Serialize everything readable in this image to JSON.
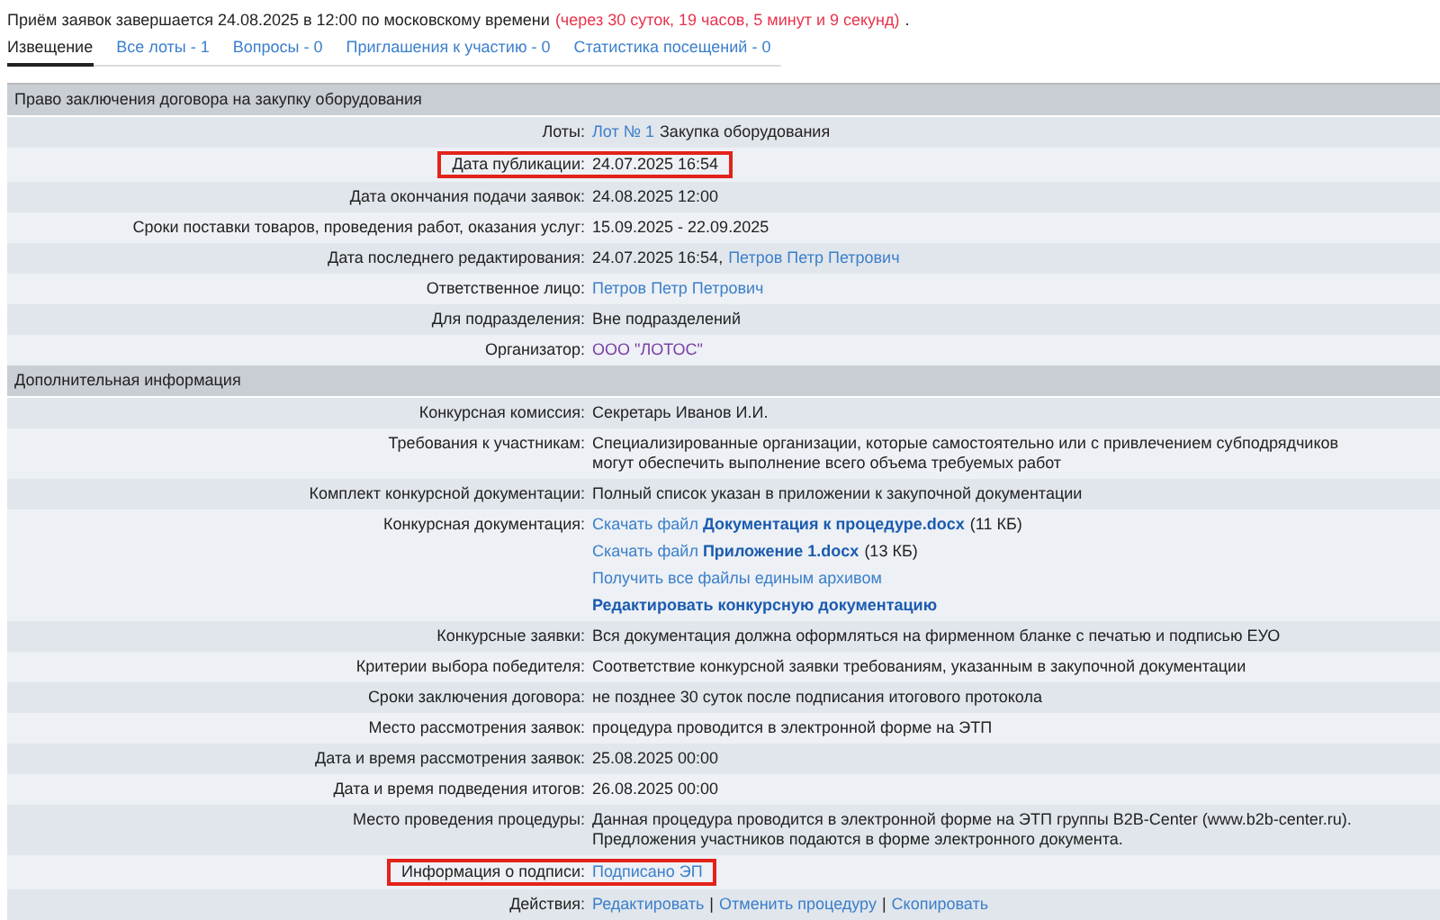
{
  "notice": {
    "text": "Приём заявок завершается 24.08.2025 в 12:00 по московскому времени",
    "countdown": "(через 30 суток, 19 часов, 5 минут и 9 секунд)",
    "end": "."
  },
  "tabs": [
    {
      "label": "Извещение",
      "selected": true
    },
    {
      "label": "Все лоты - 1",
      "selected": false
    },
    {
      "label": "Вопросы - 0",
      "selected": false
    },
    {
      "label": "Приглашения к участию - 0",
      "selected": false
    },
    {
      "label": "Статистика посещений - 0",
      "selected": false
    }
  ],
  "sections": [
    {
      "title": "Право заключения договора на закупку оборудования",
      "rows": [
        {
          "label": "Лоты:",
          "highlighted": false,
          "lines": [
            [
              {
                "kind": "link",
                "text": "Лот № 1"
              },
              {
                "kind": "text",
                "text": "Закупка оборудования"
              }
            ]
          ]
        },
        {
          "label": "Дата публикации:",
          "highlighted": true,
          "lines": [
            [
              {
                "kind": "text",
                "text": "24.07.2025 16:54"
              }
            ]
          ]
        },
        {
          "label": "Дата окончания подачи заявок:",
          "highlighted": false,
          "lines": [
            [
              {
                "kind": "text",
                "text": "24.08.2025 12:00"
              }
            ]
          ]
        },
        {
          "label": "Сроки поставки товаров, проведения работ, оказания услуг:",
          "highlighted": false,
          "lines": [
            [
              {
                "kind": "text",
                "text": "15.09.2025 - 22.09.2025"
              }
            ]
          ]
        },
        {
          "label": "Дата последнего редактирования:",
          "highlighted": false,
          "lines": [
            [
              {
                "kind": "text",
                "text": "24.07.2025 16:54,"
              },
              {
                "kind": "link",
                "text": "Петров Петр Петрович"
              }
            ]
          ]
        },
        {
          "label": "Ответственное лицо:",
          "highlighted": false,
          "lines": [
            [
              {
                "kind": "link",
                "text": "Петров Петр Петрович"
              }
            ]
          ]
        },
        {
          "label": "Для подразделения:",
          "highlighted": false,
          "lines": [
            [
              {
                "kind": "text",
                "text": "Вне подразделений"
              }
            ]
          ]
        },
        {
          "label": "Организатор:",
          "highlighted": false,
          "lines": [
            [
              {
                "kind": "visited",
                "text": "ООО \"ЛОТОС\""
              }
            ]
          ]
        }
      ]
    },
    {
      "title": "Дополнительная информация",
      "rows": [
        {
          "label": "Конкурсная комиссия:",
          "highlighted": false,
          "lines": [
            [
              {
                "kind": "text",
                "text": "Секретарь Иванов И.И."
              }
            ]
          ]
        },
        {
          "label": "Требования к участникам:",
          "highlighted": false,
          "lines": [
            [
              {
                "kind": "text",
                "text": "Специализированные организации, которые самостоятельно или с привлечением субподрядчиков могут обеспечить выполнение всего объема требуемых работ"
              }
            ]
          ]
        },
        {
          "label": "Комплект конкурсной документации:",
          "highlighted": false,
          "lines": [
            [
              {
                "kind": "text",
                "text": "Полный список указан в приложении к закупочной документации"
              }
            ]
          ]
        },
        {
          "label": "Конкурсная документация:",
          "highlighted": false,
          "lines": [
            [
              {
                "kind": "link",
                "text": "Скачать файл **Документация к процедуре.docx**"
              },
              {
                "kind": "text",
                "text": "(11 КБ)"
              }
            ],
            [
              {
                "kind": "link",
                "text": "Скачать файл **Приложение 1.docx**"
              },
              {
                "kind": "text",
                "text": "(13 КБ)"
              }
            ],
            [
              {
                "kind": "link",
                "text": "Получить все файлы единым архивом"
              }
            ],
            [
              {
                "kind": "strong-link",
                "text": "Редактировать конкурсную документацию"
              }
            ]
          ]
        },
        {
          "label": "Конкурсные заявки:",
          "highlighted": false,
          "lines": [
            [
              {
                "kind": "text",
                "text": "Вся документация должна оформляться на фирменном бланке с печатью и подписью ЕУО"
              }
            ]
          ]
        },
        {
          "label": "Критерии выбора победителя:",
          "highlighted": false,
          "lines": [
            [
              {
                "kind": "text",
                "text": "Соответствие конкурсной заявки требованиям, указанным в закупочной документации"
              }
            ]
          ]
        },
        {
          "label": "Сроки заключения договора:",
          "highlighted": false,
          "lines": [
            [
              {
                "kind": "text",
                "text": "не позднее 30 суток после подписания итогового протокола"
              }
            ]
          ]
        },
        {
          "label": "Место рассмотрения заявок:",
          "highlighted": false,
          "lines": [
            [
              {
                "kind": "text",
                "text": "процедура проводится в электронной форме на ЭТП"
              }
            ]
          ]
        },
        {
          "label": "Дата и время рассмотрения заявок:",
          "highlighted": false,
          "lines": [
            [
              {
                "kind": "text",
                "text": "25.08.2025 00:00"
              }
            ]
          ]
        },
        {
          "label": "Дата и время подведения итогов:",
          "highlighted": false,
          "lines": [
            [
              {
                "kind": "text",
                "text": "26.08.2025 00:00"
              }
            ]
          ]
        },
        {
          "label": "Место проведения процедуры:",
          "highlighted": false,
          "lines": [
            [
              {
                "kind": "text",
                "text": "Данная процедура проводится в электронной форме на ЭТП группы B2B-Center (www.b2b-center.ru). Предложения участников подаются в форме электронного документа."
              }
            ]
          ]
        },
        {
          "label": "Информация о подписи:",
          "highlighted": true,
          "lines": [
            [
              {
                "kind": "link",
                "text": "Подписано ЭП"
              }
            ]
          ]
        },
        {
          "label": "Действия:",
          "highlighted": false,
          "lines": [
            [
              {
                "kind": "link",
                "text": "Редактировать"
              },
              {
                "kind": "text",
                "text": "|"
              },
              {
                "kind": "link",
                "text": "Отменить процедуру"
              },
              {
                "kind": "text",
                "text": "|"
              },
              {
                "kind": "link",
                "text": "Скопировать"
              }
            ]
          ]
        }
      ]
    }
  ]
}
